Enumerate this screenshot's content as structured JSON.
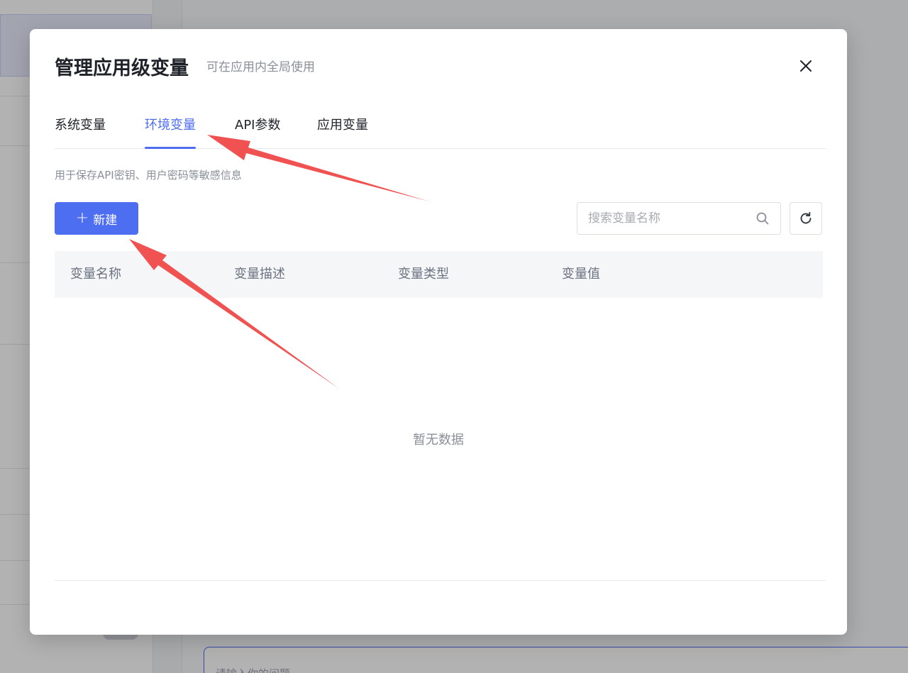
{
  "background": {
    "input_placeholder": "请输入你的问题"
  },
  "modal": {
    "title": "管理应用级变量",
    "subtitle": "可在应用内全局使用",
    "close_icon": "close-icon",
    "tabs": [
      {
        "label": "系统变量",
        "active": false
      },
      {
        "label": "环境变量",
        "active": true
      },
      {
        "label": "API参数",
        "active": false
      },
      {
        "label": "应用变量",
        "active": false
      }
    ],
    "description": "用于保存API密钥、用户密码等敏感信息",
    "new_button": {
      "label": "新建",
      "icon": "plus-icon"
    },
    "search": {
      "placeholder": "搜索变量名称",
      "value": "",
      "icon": "search-icon"
    },
    "refresh_icon": "refresh-icon",
    "table": {
      "columns": [
        "变量名称",
        "变量描述",
        "变量类型",
        "变量值"
      ],
      "rows": [],
      "empty_text": "暂无数据"
    }
  },
  "colors": {
    "accent": "#4e6ef2",
    "annotation_arrow": "#f05252"
  }
}
